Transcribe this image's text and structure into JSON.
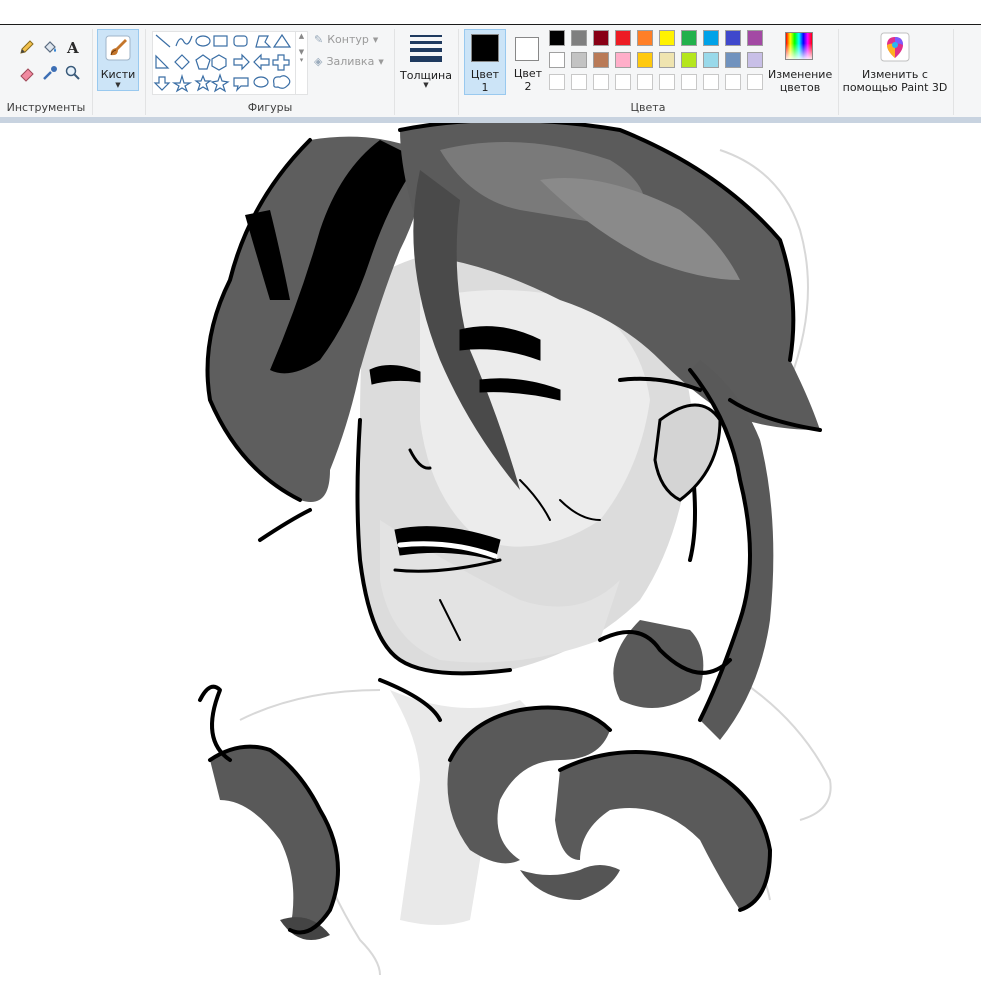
{
  "ribbon": {
    "tools_group_label": "Инструменты",
    "brushes_label": "Кисти",
    "shapes_group_label": "Фигуры",
    "outline_label": "Контур",
    "fill_label": "Заливка",
    "thickness_label": "Толщина",
    "color1_label_line1": "Цвет",
    "color1_label_line2": "1",
    "color2_label_line1": "Цвет",
    "color2_label_line2": "2",
    "colors_group_label": "Цвета",
    "edit_colors_line1": "Изменение",
    "edit_colors_line2": "цветов",
    "paint3d_line1": "Изменить с",
    "paint3d_line2": "помощью Paint 3D"
  },
  "colors": {
    "color1": "#000000",
    "color2": "#ffffff",
    "palette_row1": [
      "#000000",
      "#7f7f7f",
      "#880015",
      "#ed1c24",
      "#ff7f27",
      "#fff200",
      "#22b14c",
      "#00a2e8",
      "#3f48cc",
      "#a349a4"
    ],
    "palette_row2": [
      "#ffffff",
      "#c3c3c3",
      "#b97a57",
      "#ffaec9",
      "#ffc90e",
      "#efe4b0",
      "#b5e61d",
      "#99d9ea",
      "#7092be",
      "#c8bfe7"
    ],
    "selected_accent": "#cce4f7"
  },
  "icons": [
    "pencil-icon",
    "fill-bucket-icon",
    "text-icon",
    "eraser-icon",
    "color-picker-icon",
    "magnifier-icon",
    "brush-icon",
    "paint3d-icon",
    "edit-colors-icon"
  ]
}
